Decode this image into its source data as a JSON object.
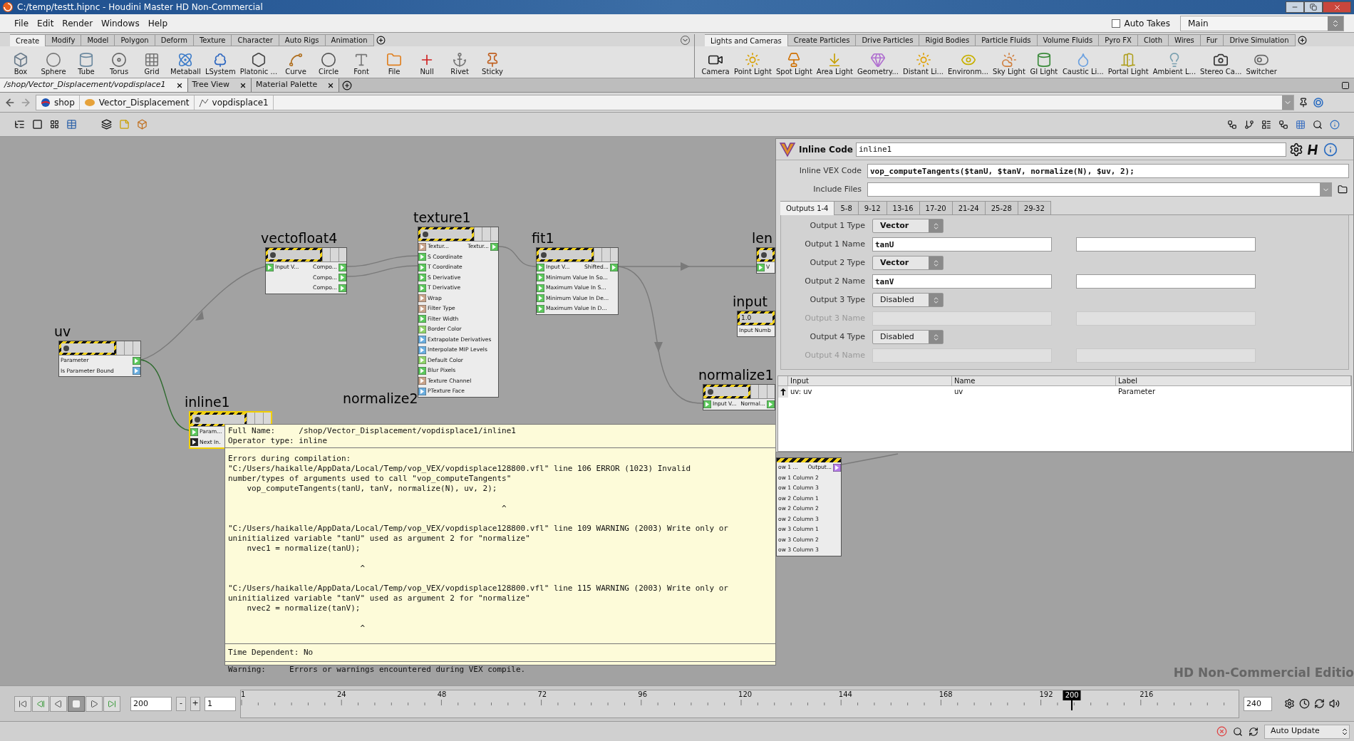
{
  "window": {
    "title": "C:/temp/testt.hipnc - Houdini Master HD Non-Commercial"
  },
  "menu": [
    "File",
    "Edit",
    "Render",
    "Windows",
    "Help"
  ],
  "auto_takes": {
    "label": "Auto Takes",
    "checked": false
  },
  "take": {
    "value": "Main"
  },
  "shelf_left": {
    "tabs": [
      {
        "label": "Create",
        "selected": true
      },
      {
        "label": "Modify",
        "selected": false
      },
      {
        "label": "Model",
        "selected": false
      },
      {
        "label": "Polygon",
        "selected": false
      },
      {
        "label": "Deform",
        "selected": false
      },
      {
        "label": "Texture",
        "selected": false
      },
      {
        "label": "Character",
        "selected": false
      },
      {
        "label": "Auto Rigs",
        "selected": false
      },
      {
        "label": "Animation",
        "selected": false
      }
    ],
    "tools": [
      "Box",
      "Sphere",
      "Tube",
      "Torus",
      "Grid",
      "Metaball",
      "LSystem",
      "Platonic ...",
      "Curve",
      "Circle",
      "Font",
      "File",
      "Null",
      "Rivet",
      "Sticky"
    ]
  },
  "shelf_right": {
    "tabs": [
      {
        "label": "Lights and Cameras",
        "selected": true
      },
      {
        "label": "Create Particles",
        "selected": false
      },
      {
        "label": "Drive Particles",
        "selected": false
      },
      {
        "label": "Rigid Bodies",
        "selected": false
      },
      {
        "label": "Particle Fluids",
        "selected": false
      },
      {
        "label": "Volume Fluids",
        "selected": false
      },
      {
        "label": "Pyro FX",
        "selected": false
      },
      {
        "label": "Cloth",
        "selected": false
      },
      {
        "label": "Wires",
        "selected": false
      },
      {
        "label": "Fur",
        "selected": false
      },
      {
        "label": "Drive Simulation",
        "selected": false
      }
    ],
    "tools": [
      "Camera",
      "Point Light",
      "Spot Light",
      "Area Light",
      "Geometry...",
      "Distant Li...",
      "Environm...",
      "Sky Light",
      "GI Light",
      "Caustic Li...",
      "Portal Light",
      "Ambient L...",
      "Stereo Ca...",
      "Switcher"
    ]
  },
  "pane_tabs": [
    {
      "label": "/shop/Vector_Displacement/vopdisplace1",
      "selected": true
    },
    {
      "label": "Tree View",
      "selected": false
    },
    {
      "label": "Material Palette",
      "selected": false
    }
  ],
  "path": [
    "shop",
    "Vector_Displacement",
    "vopdisplace1"
  ],
  "nodes": [
    {
      "kind": "full",
      "name": "texture1",
      "selected": false,
      "rows": [
        {
          "label": "Textur...",
          "color": "#c9a38a",
          "output": {
            "label": "Textur...",
            "color": "#5cc85c"
          }
        },
        {
          "label": "S Coordinate",
          "color": "#5cc85c"
        },
        {
          "label": "T Coordinate",
          "color": "#5cc85c"
        },
        {
          "label": "S Derivative",
          "color": "#5cc85c"
        },
        {
          "label": "T Derivative",
          "color": "#5cc85c"
        },
        {
          "label": "Wrap",
          "color": "#c9a38a"
        },
        {
          "label": "Filter Type",
          "color": "#c9a38a"
        },
        {
          "label": "Filter Width",
          "color": "#5cc85c"
        },
        {
          "label": "Border Color",
          "color": "#8fd36a"
        },
        {
          "label": "Extrapolate Derivatives",
          "color": "#6aaee0"
        },
        {
          "label": "Interpolate MIP Levels",
          "color": "#6aaee0"
        },
        {
          "label": "Default Color",
          "color": "#8fd36a"
        },
        {
          "label": "Blur Pixels",
          "color": "#5cc85c"
        },
        {
          "label": "Texture Channel",
          "color": "#c9a38a"
        },
        {
          "label": "PTexture Face",
          "color": "#6aaee0"
        }
      ]
    },
    {
      "kind": "full",
      "name": "vectofloat4",
      "selected": false,
      "rows": [
        {
          "label": "Input V...",
          "color": "#5cc85c",
          "output": {
            "label": "Compo...",
            "color": "#5cc85c"
          }
        },
        {
          "output": {
            "label": "Compo...",
            "color": "#5cc85c"
          }
        },
        {
          "output": {
            "label": "Compo...",
            "color": "#5cc85c"
          }
        }
      ]
    },
    {
      "kind": "full",
      "name": "fit1",
      "selected": false,
      "rows": [
        {
          "label": "Input V...",
          "color": "#5cc85c",
          "output": {
            "label": "Shifted...",
            "color": "#5cc85c"
          }
        },
        {
          "label": "Minimum Value In So...",
          "color": "#5cc85c"
        },
        {
          "label": "Maximum Value In S...",
          "color": "#5cc85c"
        },
        {
          "label": "Minimum Value In De...",
          "color": "#5cc85c"
        },
        {
          "label": "Maximum Value In D...",
          "color": "#5cc85c"
        }
      ]
    },
    {
      "kind": "full",
      "name": "len",
      "selected": false,
      "rows": [
        {
          "label": "V",
          "color": "#5cc85c"
        }
      ]
    },
    {
      "kind": "full",
      "name": "input",
      "value": "1.0",
      "selected": false,
      "rows": [
        {
          "label": "Input Numb"
        }
      ]
    },
    {
      "kind": "full",
      "name": "uv",
      "selected": false,
      "rows": [
        {
          "label": "Parameter",
          "output": {
            "color": "#5cc85c"
          }
        },
        {
          "label": "Is Parameter Bound",
          "output": {
            "color": "#6aaee0"
          }
        }
      ]
    },
    {
      "kind": "full",
      "name": "normalize1",
      "selected": false,
      "rows": [
        {
          "label": "Input V...",
          "color": "#5cc85c",
          "output": {
            "label": "Normal...",
            "color": "#5cc85c"
          }
        }
      ]
    },
    {
      "kind": "full",
      "name": "inline1",
      "selected": true,
      "rows": [
        {
          "label": "Param...",
          "color": "#5cc85c"
        },
        {
          "label": "Next In.",
          "color": "#222222"
        }
      ]
    },
    {
      "kind": "label",
      "name": "normalize2"
    },
    {
      "kind": "clipped",
      "selected": false,
      "rows": [
        {
          "label": "ow 1 ...",
          "output": {
            "label": "Output...",
            "color": "#b57be8"
          }
        },
        {
          "label": "ow 1 Column 2"
        },
        {
          "label": "ow 1 Column 3"
        },
        {
          "label": "ow 2 Column 1"
        },
        {
          "label": "ow 2 Column 2"
        },
        {
          "label": "ow 2 Column 3"
        },
        {
          "label": "ow 3 Column 1"
        },
        {
          "label": "ow 3 Column 2"
        },
        {
          "label": "ow 3 Column 3"
        }
      ]
    }
  ],
  "edition_mark": "HD Non-Commercial Editio",
  "parameters": {
    "type_label": "Inline Code",
    "node_name": "inline1",
    "code": {
      "label": "Inline VEX Code",
      "value": "vop_computeTangents($tanU, $tanV, normalize(N), $uv, 2);"
    },
    "include": {
      "label": "Include Files"
    },
    "tabs": [
      {
        "label": "Outputs 1-4",
        "selected": true
      },
      {
        "label": "5-8",
        "selected": false
      },
      {
        "label": "9-12",
        "selected": false
      },
      {
        "label": "13-16",
        "selected": false
      },
      {
        "label": "17-20",
        "selected": false
      },
      {
        "label": "21-24",
        "selected": false
      },
      {
        "label": "25-28",
        "selected": false
      },
      {
        "label": "29-32",
        "selected": false
      }
    ],
    "outputs": [
      {
        "kind": "type",
        "label": "Output 1 Type",
        "value": "Vector",
        "modified": true,
        "disabled": false
      },
      {
        "kind": "name",
        "label": "Output 1 Name",
        "value": "tanU",
        "modified": true,
        "disabled": false
      },
      {
        "kind": "type",
        "label": "Output 2 Type",
        "value": "Vector",
        "modified": true,
        "disabled": false
      },
      {
        "kind": "name",
        "label": "Output 2 Name",
        "value": "tanV",
        "modified": true,
        "disabled": false
      },
      {
        "kind": "type",
        "label": "Output 3 Type",
        "value": "Disabled",
        "modified": false,
        "disabled": false
      },
      {
        "kind": "name",
        "label": "Output 3 Name",
        "modified": false,
        "disabled": true
      },
      {
        "kind": "type",
        "label": "Output 4 Type",
        "value": "Disabled",
        "modified": false,
        "disabled": false
      },
      {
        "kind": "name",
        "label": "Output 4 Name",
        "modified": false,
        "disabled": true
      }
    ],
    "table": {
      "columns": [
        "Input",
        "Name",
        "Label"
      ],
      "rows": [
        [
          "uv: uv",
          "uv",
          "Parameter"
        ]
      ]
    }
  },
  "tooltip": {
    "header": [
      "Full Name:     /shop/Vector_Displacement/vopdisplace1/inline1",
      "Operator type: inline"
    ],
    "errors_title": "Errors during compilation:",
    "messages": [
      {
        "lines": [
          "\"C:/Users/haikalle/AppData/Local/Temp/vop_VEX/vopdisplace128800.vfl\" line 106 ERROR (1023) Invalid",
          "number/types of arguments used to call \"vop_computeTangents\"",
          "    vop_computeTangents(tanU, tanV, normalize(N), uv, 2);"
        ],
        "caret": "                                                          ^"
      },
      {
        "lines": [
          "\"C:/Users/haikalle/AppData/Local/Temp/vop_VEX/vopdisplace128800.vfl\" line 109 WARNING (2003) Write only or",
          "uninitialized variable \"tanU\" used as argument 2 for \"normalize\"",
          "    nvec1 = normalize(tanU);"
        ],
        "caret": "                            ^"
      },
      {
        "lines": [
          "\"C:/Users/haikalle/AppData/Local/Temp/vop_VEX/vopdisplace128800.vfl\" line 115 WARNING (2003) Write only or",
          "uninitialized variable \"tanV\" used as argument 2 for \"normalize\"",
          "    nvec2 = normalize(tanV);"
        ],
        "caret": "                            ^"
      }
    ],
    "time_dependent": "Time Dependent: No",
    "warning": "Warning:     Errors or warnings encountered during VEX compile."
  },
  "timeline": {
    "frame": "200",
    "minus": "-",
    "plus": "+",
    "step": "1",
    "ticks": [
      "1",
      "24",
      "48",
      "72",
      "96",
      "120",
      "144",
      "168",
      "192",
      "216"
    ],
    "current": "200",
    "level": 0.833,
    "end": "240"
  },
  "status": {
    "update_mode": "Auto Update"
  }
}
